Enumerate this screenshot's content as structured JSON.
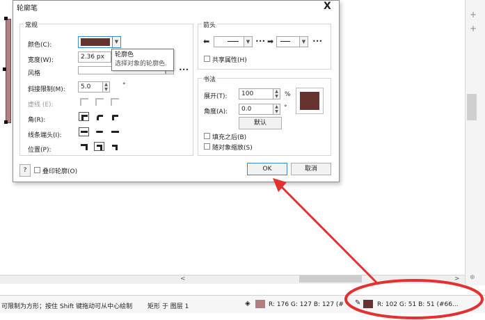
{
  "dialog": {
    "title": "轮廓笔",
    "close": "X",
    "general": {
      "group_label": "常规",
      "color_label": "颜色(C):",
      "color_value": "#66332f",
      "width_label": "宽度(W):",
      "width_value": "2.36 px",
      "style_label": "风格",
      "miter_label": "斜接限制(M):",
      "miter_value": "5.0",
      "miter_unit": "°",
      "dash_label": "虚线 (E):",
      "corner_label": "角(R):",
      "linecap_label": "线条端头(I):",
      "position_label": "位置(P):",
      "more_dots": "•••"
    },
    "arrows": {
      "group_label": "箭头",
      "share_label": "共享属性(H)"
    },
    "calligraphy": {
      "group_label": "书法",
      "stretch_label": "展开(T):",
      "stretch_value": "100",
      "stretch_unit": "%",
      "angle_label": "角度(A):",
      "angle_value": "0.0",
      "angle_unit": "°",
      "default_button": "默认",
      "behind_fill_label": "填充之后(B)",
      "scale_with_label": "随对象缩放(S)"
    },
    "help_button": "?",
    "overprint_label": "叠印轮廓(O)",
    "ok_button": "OK",
    "cancel_button": "取消"
  },
  "tooltip": {
    "title": "轮廓色",
    "description": "选择对象的轮廓色."
  },
  "statusbar": {
    "hint": "可限制为方形；按住 Shift 键拖动可从中心绘制",
    "object": "矩形 于 图层 1",
    "fill_color": "#b08080",
    "fill_rgb": "R:   176 G:   127 B:   127 (#",
    "outline_color": "#66332f",
    "outline_rgb": "R:   102 G:   51 B:   51 (#66..."
  },
  "colors": {
    "annotation_red": "#e53030",
    "outline_swatch": "#66332f"
  }
}
